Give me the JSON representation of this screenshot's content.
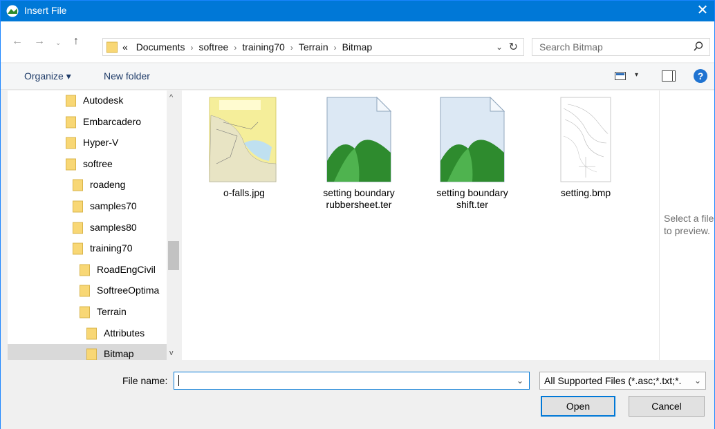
{
  "window": {
    "title": "Insert File",
    "close_glyph": "✕"
  },
  "nav": {
    "back": "←",
    "forward": "→",
    "history": "⌄",
    "up": "↑"
  },
  "address": {
    "prefix": "«",
    "crumbs": [
      "Documents",
      "softree",
      "training70",
      "Terrain",
      "Bitmap"
    ],
    "separator": "›",
    "dropdown_glyph": "⌄",
    "refresh_glyph": "↻"
  },
  "search": {
    "placeholder": "Search Bitmap"
  },
  "toolbar": {
    "organize_label": "Organize ▾",
    "new_folder_label": "New folder",
    "view_dropdown_glyph": "▾",
    "help_label": "?"
  },
  "tree": {
    "items": [
      {
        "label": "Autodesk",
        "level": 1
      },
      {
        "label": "Embarcadero",
        "level": 1
      },
      {
        "label": "Hyper-V",
        "level": 1
      },
      {
        "label": "softree",
        "level": 1
      },
      {
        "label": "roadeng",
        "level": 2
      },
      {
        "label": "samples70",
        "level": 2
      },
      {
        "label": "samples80",
        "level": 2
      },
      {
        "label": "training70",
        "level": 2
      },
      {
        "label": "RoadEngCivil",
        "level": 3
      },
      {
        "label": "SoftreeOptima",
        "level": 3
      },
      {
        "label": "Terrain",
        "level": 3
      },
      {
        "label": "Attributes",
        "level": 4
      },
      {
        "label": "Bitmap",
        "level": 4,
        "selected": true
      }
    ],
    "scroll_up_glyph": "^",
    "scroll_down_glyph": "v"
  },
  "files": [
    {
      "name": "o-falls.jpg",
      "icon": "map-thumbnail"
    },
    {
      "name": "setting boundary rubbersheet.ter",
      "icon": "terrain-file-icon"
    },
    {
      "name": "setting boundary shift.ter",
      "icon": "terrain-file-icon"
    },
    {
      "name": "setting.bmp",
      "icon": "contour-thumbnail"
    }
  ],
  "preview": {
    "line1": "Select a file",
    "line2": "to preview."
  },
  "bottom": {
    "file_name_label": "File name:",
    "file_name_value": "",
    "file_type": "All Supported Files (*.asc;*.txt;*.",
    "dropdown_glyph": "⌄",
    "open_label": "Open",
    "cancel_label": "Cancel"
  },
  "colors": {
    "accent": "#0078d7",
    "folder": "#f8d775",
    "terrain_green": "#2e8b2e"
  }
}
